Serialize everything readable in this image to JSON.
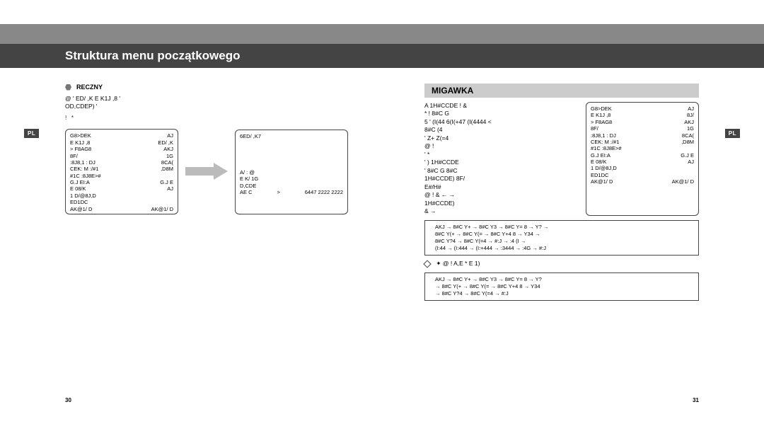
{
  "lang": "PL",
  "header": {
    "title": "Struktura menu początkowego"
  },
  "left": {
    "bullet": "RECZNY",
    "intro1": "@ '        ED/ ,K       E K1J ,8  '",
    "intro2": "        OD,CDEP)    '",
    "footline": "!                               *",
    "panel1": {
      "r1a": "   G8>DEK",
      "r1b": "AJ",
      "r2a": "E K1J ,8",
      "r2b": "ED/ ,K",
      "r3a": "> F8AG8",
      "r3b": "AKJ",
      "r4a": "8F/",
      "r4b": "1G",
      "r5a": ":8J8,1 : DJ",
      "r5b": "8CA(",
      "r6a": "CEK: M :/#1",
      "r6b": ",D8M",
      "r7a": "#1C :8J8E>#",
      "r8a": "G.J EI:A",
      "r8b": "G.J E",
      "r9a": "E 08/K",
      "r9b": "AJ",
      "r10a": "1 D/@8J,D",
      "r11a": "ED1DC",
      "r12a": "AK@1/ D",
      "r12b": "AK@1/ D"
    },
    "panel2": {
      "r1": "6ED/ ,K7",
      "r6a": "A/ : @",
      "r7a": "E K/ 1G",
      "r8a": "D,CDE",
      "r9a": "AE C",
      "r9m": ">",
      "r9v": "6447   2222 2222"
    },
    "page": "30"
  },
  "right": {
    "section": "MIGAWKA",
    "d1": "A              1H#CCDE  !   &",
    "d2": "                  * !              8#C  G",
    "d3": "5   '   (I(44 6(I(+47               (I(4444         <",
    "d4": "                                                 8#C   (4",
    "d5": "'    Z+  Z(=4",
    "d6": "                               @ !",
    "d7": "'                       *",
    "d8": "'       )           1H#CCDE",
    "d9": "'   8#C  G               8#C",
    "d10": "1H#CCDE)     8F/",
    "d11": "E#/H#",
    "d12": "@ !         &       ←  →",
    "d13": "     1H#CCDE)",
    "d14": "   &                →",
    "panel": {
      "r1a": "   G8>DEK",
      "r1b": "AJ",
      "r2a": "E K1J ,8",
      "r2b": "8J/",
      "r3a": "> F8AG8",
      "r3b": "AKJ",
      "r4a": "8F/",
      "r4b": "1G",
      "r5a": ":8J8,1 : DJ",
      "r5b": "8CA(",
      "r6a": "CEK: M :/#1",
      "r6b": ",D8M",
      "r7a": "#1C :8J8E>#",
      "r8a": "G.J EI:A",
      "r8b": "G.J E",
      "r9a": "E 08/K",
      "r9b": "AJ",
      "r10a": "1 D/@8J,D",
      "r11a": "ED1DC",
      "r12a": "AK@1/ D",
      "r12b": "AK@1/ D"
    },
    "flow1": {
      "l1": "AKJ  → 8#C Y+  → 8#C Y3   → 8#C Y=   8 → Y?   →",
      "l2": "8#C Y(+  → 8#C Y(=   → 8#C Y+4   8 → Y34   →",
      "l3": "8#C Y?4  → 8#C Y(=4  → #:J       → :4     (I →",
      "l4": "(I:44  → (I:444  → (I:+444  → :3444  → :4G  → #:J"
    },
    "midline": "✦ @ !        A,E      *    E 1)",
    "flow2": {
      "l1": "AKJ  → 8#C Y+  → 8#C Y3   → 8#C Y=   8 → Y?",
      "l2": "→ 8#C Y(+  → 8#C Y(=   → 8#C Y+4   8 → Y34",
      "l3": "→ 8#C Y?4  → 8#C Y(=4  → #:J"
    },
    "page": "31"
  }
}
